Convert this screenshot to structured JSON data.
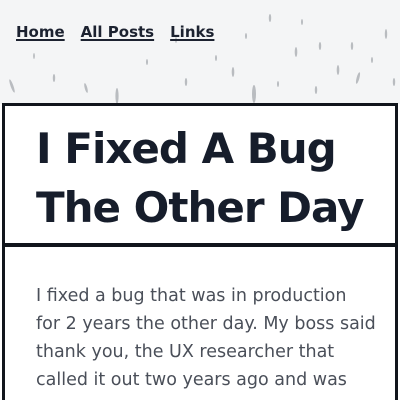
{
  "nav": {
    "items": [
      {
        "label": "Home"
      },
      {
        "label": "All Posts"
      },
      {
        "label": "Links"
      }
    ]
  },
  "post": {
    "title": "I Fixed A Bug The Other Day",
    "body": "I fixed a bug that was in production for 2 years the other day. My boss said thank you, the UX researcher that called it out two years ago and was"
  },
  "colors": {
    "header_background": "#f4f5f6",
    "border": "#11151c",
    "title_text": "#161d2b",
    "body_text": "#4a4f59",
    "nav_text": "#1c2230"
  }
}
